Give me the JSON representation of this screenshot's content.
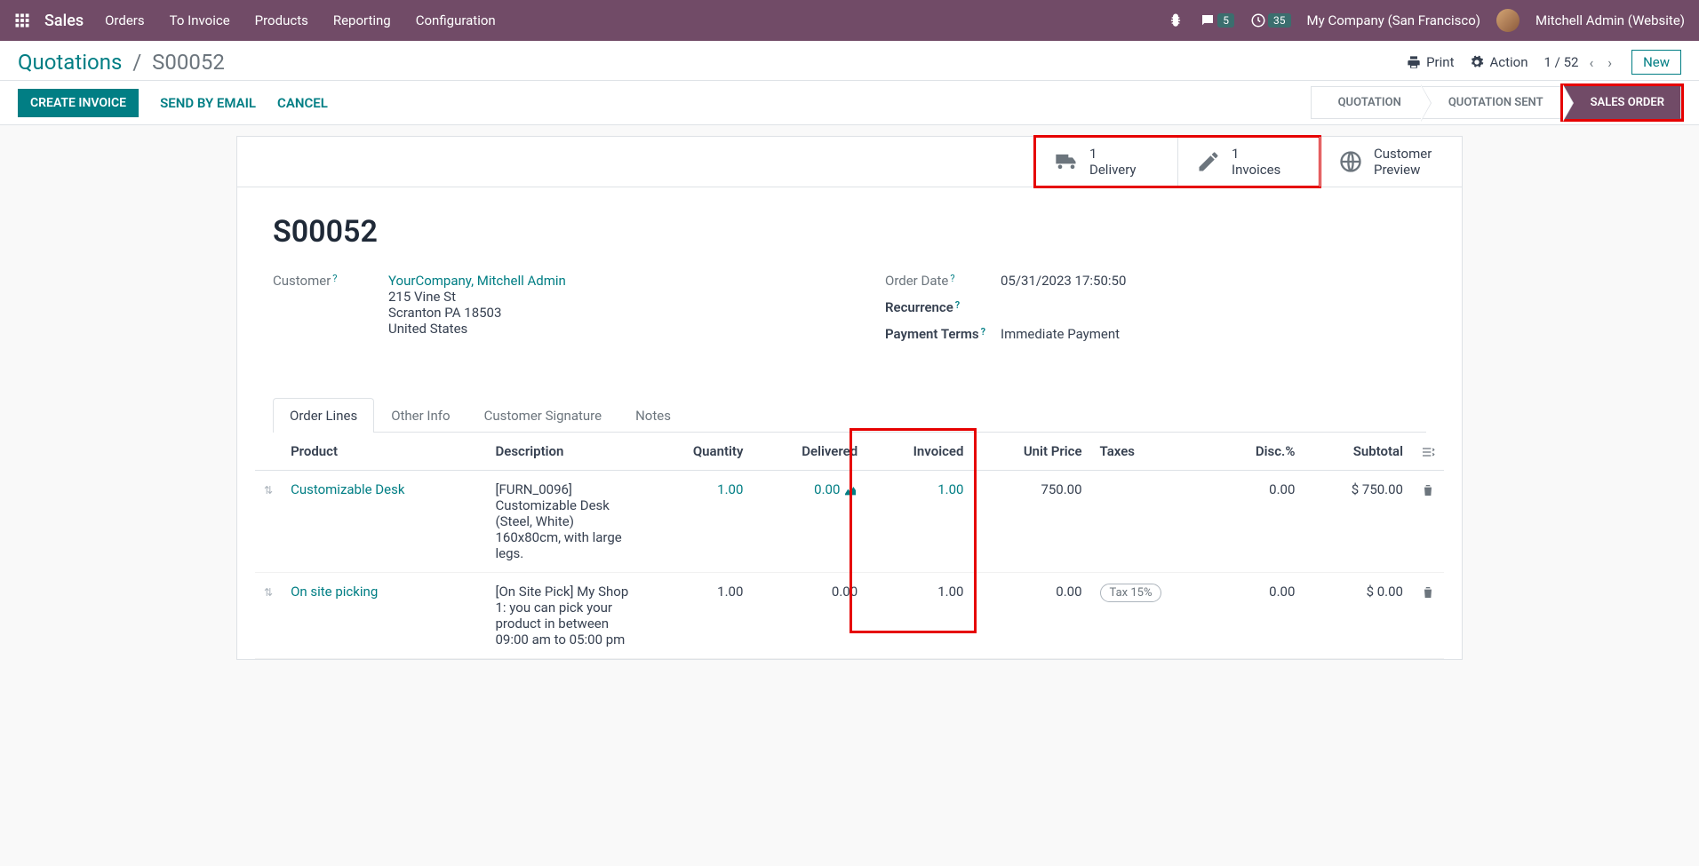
{
  "topbar": {
    "brand": "Sales",
    "nav": [
      "Orders",
      "To Invoice",
      "Products",
      "Reporting",
      "Configuration"
    ],
    "chat_badge": "5",
    "clock_badge": "35",
    "company": "My Company (San Francisco)",
    "user": "Mitchell Admin (Website)"
  },
  "crumb": {
    "root": "Quotations",
    "current": "S00052",
    "print": "Print",
    "action": "Action",
    "pager": "1 / 52",
    "new": "New"
  },
  "actions": {
    "create_invoice": "CREATE INVOICE",
    "send_email": "SEND BY EMAIL",
    "cancel": "CANCEL"
  },
  "status": {
    "quotation": "QUOTATION",
    "quotation_sent": "QUOTATION SENT",
    "sales_order": "SALES ORDER"
  },
  "stats": {
    "delivery_n": "1",
    "delivery_l": "Delivery",
    "invoices_n": "1",
    "invoices_l": "Invoices",
    "preview_l1": "Customer",
    "preview_l2": "Preview"
  },
  "form": {
    "title": "S00052",
    "customer_lbl": "Customer",
    "customer_val": "YourCompany, Mitchell Admin",
    "addr1": "215 Vine St",
    "addr2": "Scranton PA 18503",
    "addr3": "United States",
    "orderdate_lbl": "Order Date",
    "orderdate_val": "05/31/2023 17:50:50",
    "recurrence_lbl": "Recurrence",
    "payterms_lbl": "Payment Terms",
    "payterms_val": "Immediate Payment"
  },
  "tabs": [
    "Order Lines",
    "Other Info",
    "Customer Signature",
    "Notes"
  ],
  "cols": {
    "product": "Product",
    "description": "Description",
    "quantity": "Quantity",
    "delivered": "Delivered",
    "invoiced": "Invoiced",
    "unit_price": "Unit Price",
    "taxes": "Taxes",
    "disc": "Disc.%",
    "subtotal": "Subtotal"
  },
  "rows": [
    {
      "product": "Customizable Desk",
      "description": "[FURN_0096] Customizable Desk (Steel, White) 160x80cm, with large legs.",
      "quantity": "1.00",
      "delivered": "0.00",
      "invoiced": "1.00",
      "unit_price": "750.00",
      "taxes": "",
      "disc": "0.00",
      "subtotal": "$ 750.00",
      "qty_link": true,
      "delivered_icon": true
    },
    {
      "product": "On site picking",
      "description": "[On Site Pick] My Shop 1: you can pick your product in between 09:00 am to 05:00 pm",
      "quantity": "1.00",
      "delivered": "0.00",
      "invoiced": "1.00",
      "unit_price": "0.00",
      "taxes": "Tax 15%",
      "disc": "0.00",
      "subtotal": "$ 0.00"
    }
  ]
}
